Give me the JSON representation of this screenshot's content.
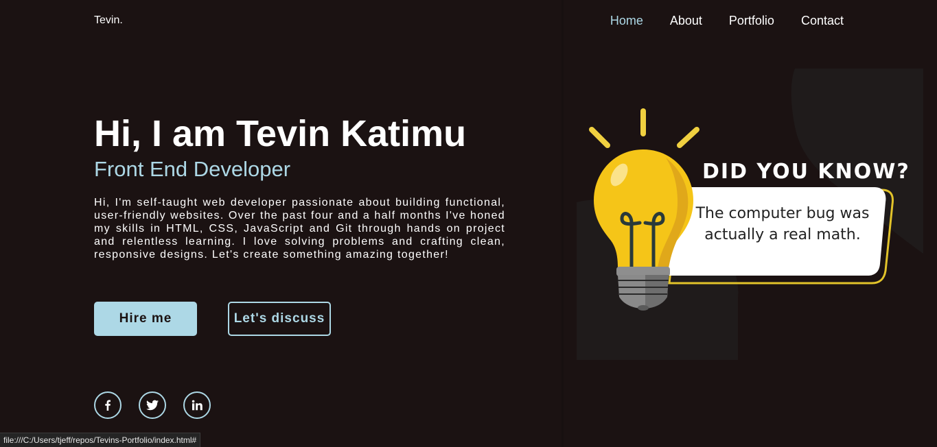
{
  "header": {
    "logo": "Tevin.",
    "nav": [
      {
        "label": "Home",
        "active": true
      },
      {
        "label": "About",
        "active": false
      },
      {
        "label": "Portfolio",
        "active": false
      },
      {
        "label": "Contact",
        "active": false
      }
    ]
  },
  "hero": {
    "title": "Hi, I am Tevin Katimu",
    "subtitle": "Front End Developer",
    "description": "Hi, I'm self-taught web developer passionate about building functional, user-friendly websites. Over the past four and a half months I've honed my skills in HTML, CSS, JavaScript and Git through hands on project and relentless learning. I love solving problems and crafting clean, responsive designs. Let's create something amazing together!",
    "hire_button": "Hire me",
    "discuss_button": "Let's discuss"
  },
  "social": [
    {
      "icon": "facebook-icon"
    },
    {
      "icon": "twitter-icon"
    },
    {
      "icon": "linkedin-icon"
    }
  ],
  "illustration": {
    "heading": "DID YOU KNOW?",
    "fact": "The computer bug was actually a real math.",
    "icon": "lightbulb-icon"
  },
  "status_bar": {
    "url": "file:///C:/Users/tjeff/repos/Tevins-Portfolio/index.html#"
  },
  "colors": {
    "background": "#1b1212",
    "accent": "#add8e6",
    "bulb": "#f5c518",
    "bulb_shadow": "#e0a81a",
    "bubble_outline": "#e2c32a"
  }
}
